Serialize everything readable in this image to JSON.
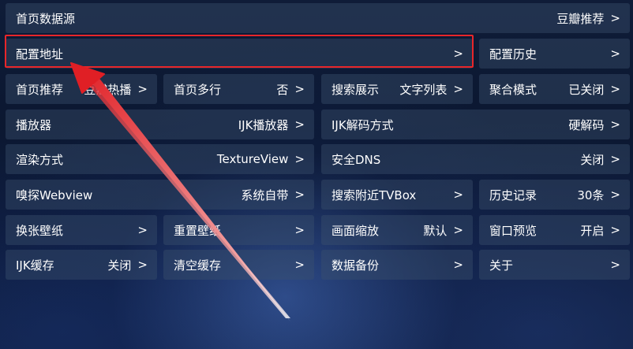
{
  "rows": {
    "r1": {
      "home_source": {
        "label": "首页数据源",
        "value": "豆瓣推荐"
      }
    },
    "r2": {
      "config_address": {
        "label": "配置地址"
      },
      "config_history": {
        "label": "配置历史"
      }
    },
    "r3": {
      "home_recommend": {
        "label": "首页推荐",
        "value": "豆瓣热播"
      },
      "home_multi_row": {
        "label": "首页多行",
        "value": "否"
      },
      "search_display": {
        "label": "搜索展示",
        "value": "文字列表"
      },
      "aggregate_mode": {
        "label": "聚合模式",
        "value": "已关闭"
      }
    },
    "r4": {
      "player": {
        "label": "播放器",
        "value": "IJK播放器"
      },
      "ijk_decode": {
        "label": "IJK解码方式",
        "value": "硬解码"
      }
    },
    "r5": {
      "render_mode": {
        "label": "渲染方式",
        "value": "TextureView"
      },
      "secure_dns": {
        "label": "安全DNS",
        "value": "关闭"
      }
    },
    "r6": {
      "sniff_webview": {
        "label": "嗅探Webview",
        "value": "系统自带"
      },
      "search_nearby": {
        "label": "搜索附近TVBox"
      },
      "history": {
        "label": "历史记录",
        "value": "30条"
      }
    },
    "r7": {
      "change_wallpaper": {
        "label": "换张壁纸"
      },
      "reset_wallpaper": {
        "label": "重置壁纸"
      },
      "screen_zoom": {
        "label": "画面缩放",
        "value": "默认"
      },
      "window_preview": {
        "label": "窗口预览",
        "value": "开启"
      }
    },
    "r8": {
      "ijk_cache": {
        "label": "IJK缓存",
        "value": "关闭"
      },
      "clear_cache": {
        "label": "清空缓存"
      },
      "data_backup": {
        "label": "数据备份"
      },
      "about": {
        "label": "关于"
      }
    }
  },
  "arrow_glyph": ">",
  "colors": {
    "highlight": "#e8262a",
    "cell_bg": "rgba(60,80,110,0.42)",
    "text": "#ffffff"
  }
}
